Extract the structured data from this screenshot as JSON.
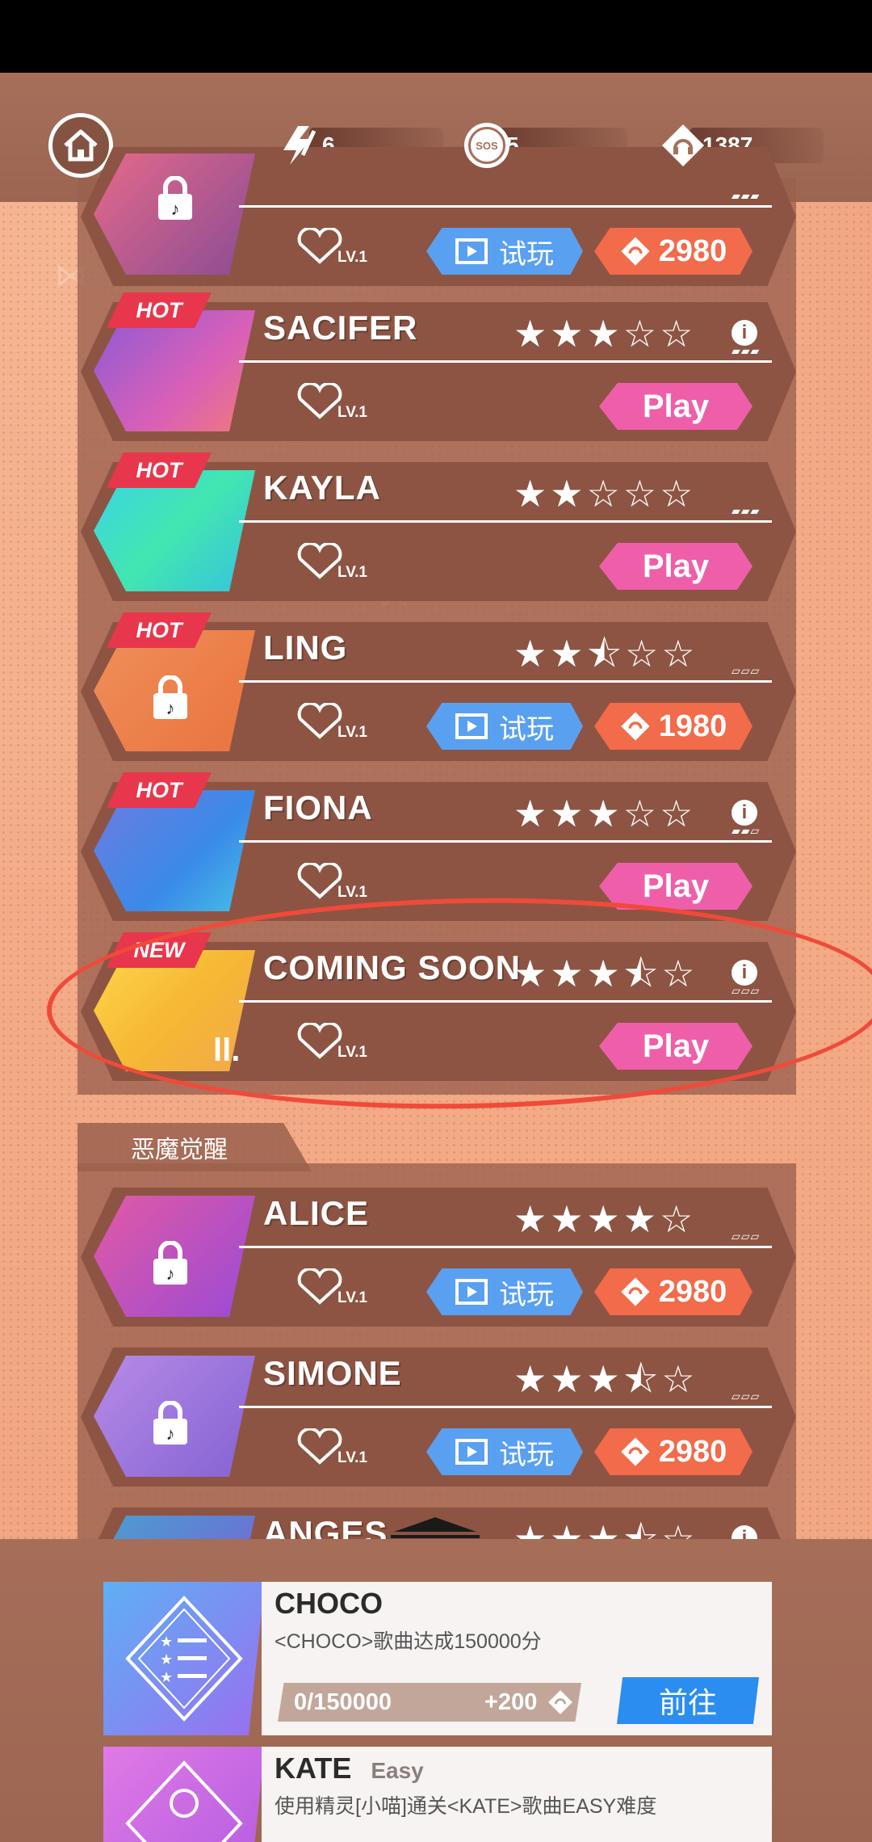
{
  "header": {
    "energy": "6",
    "sos_label": "SOS",
    "sos": "5",
    "coins": "1387"
  },
  "songs": [
    {
      "name": "",
      "badge": "",
      "stars": "",
      "level": "LV.1",
      "trial": "试玩",
      "price": "2980"
    },
    {
      "name": "SACIFER",
      "badge": "HOT",
      "stars": "★★★☆☆",
      "level": "LV.1",
      "play": "Play"
    },
    {
      "name": "KAYLA",
      "badge": "HOT",
      "stars": "★★☆☆☆",
      "level": "LV.1",
      "play": "Play"
    },
    {
      "name": "LING",
      "badge": "HOT",
      "stars": "★★⯪☆☆",
      "level": "LV.1",
      "trial": "试玩",
      "price": "1980"
    },
    {
      "name": "FIONA",
      "badge": "HOT",
      "stars": "★★★☆☆",
      "level": "LV.1",
      "play": "Play"
    },
    {
      "name": "COMING SOON",
      "badge": "NEW",
      "stars": "★★★⯪☆",
      "level": "LV.1",
      "play": "Play",
      "mark": "ll."
    }
  ],
  "section": {
    "title": "恶魔觉醒"
  },
  "songs2": [
    {
      "name": "ALICE",
      "stars": "★★★★☆",
      "level": "LV.1",
      "trial": "试玩",
      "price": "2980"
    },
    {
      "name": "SIMONE",
      "stars": "★★★⯪☆",
      "level": "LV.1",
      "trial": "试玩",
      "price": "2980"
    },
    {
      "name": "ANGES",
      "stars": "★★★⯪☆"
    }
  ],
  "tasks": [
    {
      "title": "CHOCO",
      "desc": "<CHOCO>歌曲达成150000分",
      "progress": "0/150000",
      "reward": "+200",
      "go": "前往"
    },
    {
      "title": "KATE",
      "difficulty": "Easy",
      "desc": "使用精灵[小喵]通关<KATE>歌曲EASY难度"
    }
  ],
  "colors": {
    "play": "#ef5fa9",
    "trial": "#5aa0f0",
    "buy": "#f26b4a",
    "hot": "#e8364c",
    "go": "#2c8df0"
  }
}
